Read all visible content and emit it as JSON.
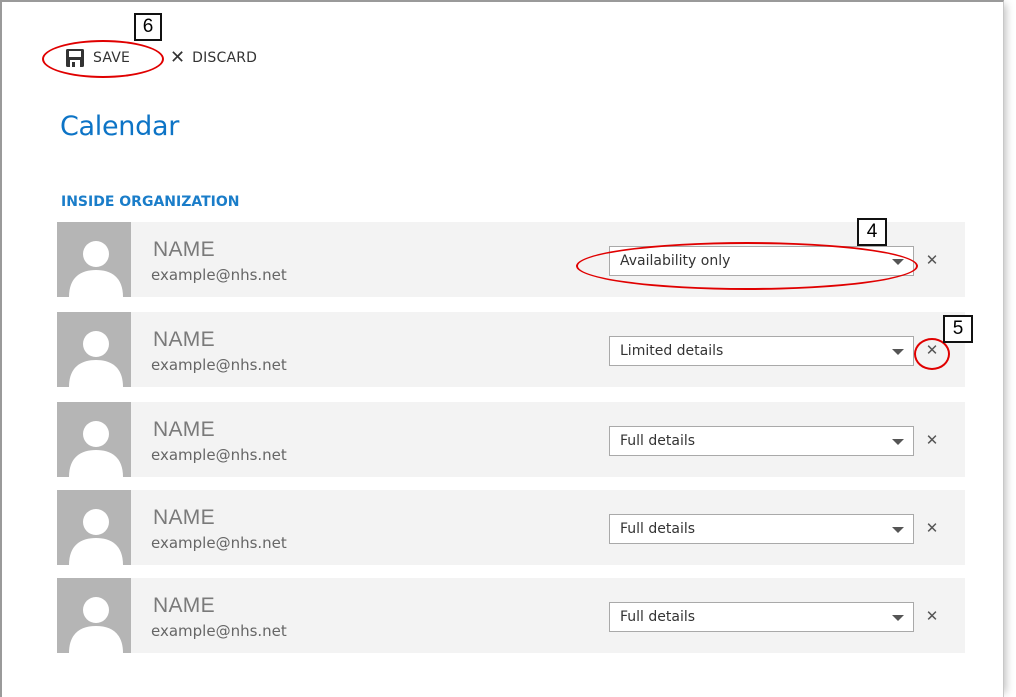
{
  "toolbar": {
    "save_label": "SAVE",
    "discard_label": "DISCARD"
  },
  "page": {
    "title": "Calendar",
    "section_title": "INSIDE ORGANIZATION"
  },
  "permission_options": [
    "Availability only",
    "Limited details",
    "Full details"
  ],
  "rows": [
    {
      "name": "NAME",
      "email": "example@nhs.net",
      "permission": "Availability only"
    },
    {
      "name": "NAME",
      "email": "example@nhs.net",
      "permission": "Limited details"
    },
    {
      "name": "NAME",
      "email": "example@nhs.net",
      "permission": "Full details"
    },
    {
      "name": "NAME",
      "email": "example@nhs.net",
      "permission": "Full details"
    },
    {
      "name": "NAME",
      "email": "example@nhs.net",
      "permission": "Full details"
    }
  ],
  "annotations": {
    "save": "6",
    "permission_dropdown": "4",
    "remove_button": "5"
  },
  "colors": {
    "accent": "#0d74c6",
    "annotation": "#e00000",
    "row_background": "#f3f3f3",
    "avatar_background": "#b5b5b5"
  }
}
